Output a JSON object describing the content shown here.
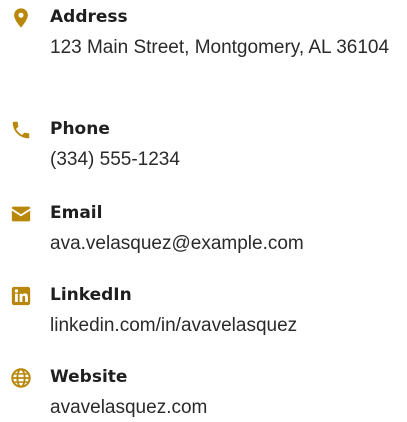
{
  "accent_color": "#b8870b",
  "items": [
    {
      "icon": "map-pin-icon",
      "label": "Address",
      "value": "123 Main Street, Montgomery, AL 36104"
    },
    {
      "icon": "phone-icon",
      "label": "Phone",
      "value": "(334) 555-1234"
    },
    {
      "icon": "envelope-icon",
      "label": "Email",
      "value": "ava.velasquez@example.com"
    },
    {
      "icon": "linkedin-icon",
      "label": "LinkedIn",
      "value": "linkedin.com/in/avavelasquez"
    },
    {
      "icon": "globe-icon",
      "label": "Website",
      "value": "avavelasquez.com"
    }
  ]
}
